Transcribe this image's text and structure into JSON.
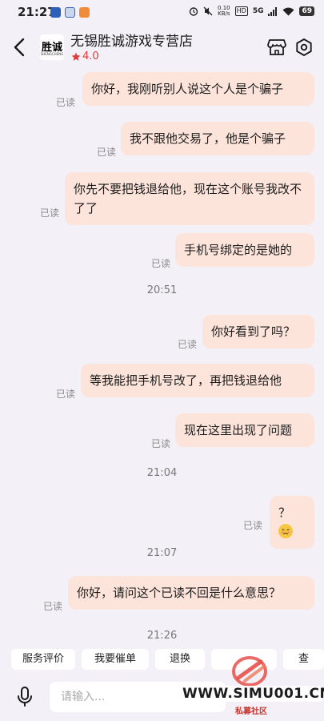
{
  "status_bar": {
    "time": "21:27",
    "net_speed_value": "0.10",
    "net_speed_unit": "KB/s",
    "hd": "HD",
    "network": "5G",
    "battery": "69"
  },
  "header": {
    "shop_name": "无锡胜诚游戏专营店",
    "logo_text": "胜诚",
    "logo_subtext": "SHENGCHENG",
    "rating": "4.0"
  },
  "messages": [
    {
      "text": "你好，我刚听别人说这个人是个骗子",
      "status": "已读"
    },
    {
      "text": "我不跟他交易了，他是个骗子",
      "status": "已读"
    },
    {
      "text": "你先不要把钱退给他，现在这个账号我改不了了",
      "status": "已读"
    },
    {
      "text": "手机号绑定的是她的",
      "status": "已读"
    },
    {
      "time": "20:51"
    },
    {
      "text": "你好看到了吗？",
      "status": "已读"
    },
    {
      "text": "等我能把手机号改了，再把钱退给他",
      "status": "已读"
    },
    {
      "text": "现在这里出现了问题",
      "status": "已读"
    },
    {
      "time": "21:04"
    },
    {
      "text": "？",
      "emoji": "woozy-face",
      "status": "已读"
    },
    {
      "time": "21:07"
    },
    {
      "text": "你好，请问这个已读不回是什么意思？",
      "status": "已读"
    },
    {
      "time": "21:26"
    }
  ],
  "quick_actions": [
    "服务评价",
    "我要催单",
    "退换",
    "",
    "查"
  ],
  "input": {
    "placeholder": "请输入..."
  },
  "watermark": {
    "text": "WWW.SIMU001.CN",
    "subtext": "私募社区"
  },
  "colors": {
    "bubble": "#fde4db",
    "background": "#f3f1f7",
    "rating": "#e03a3a",
    "watermark_red": "#c8342c"
  }
}
